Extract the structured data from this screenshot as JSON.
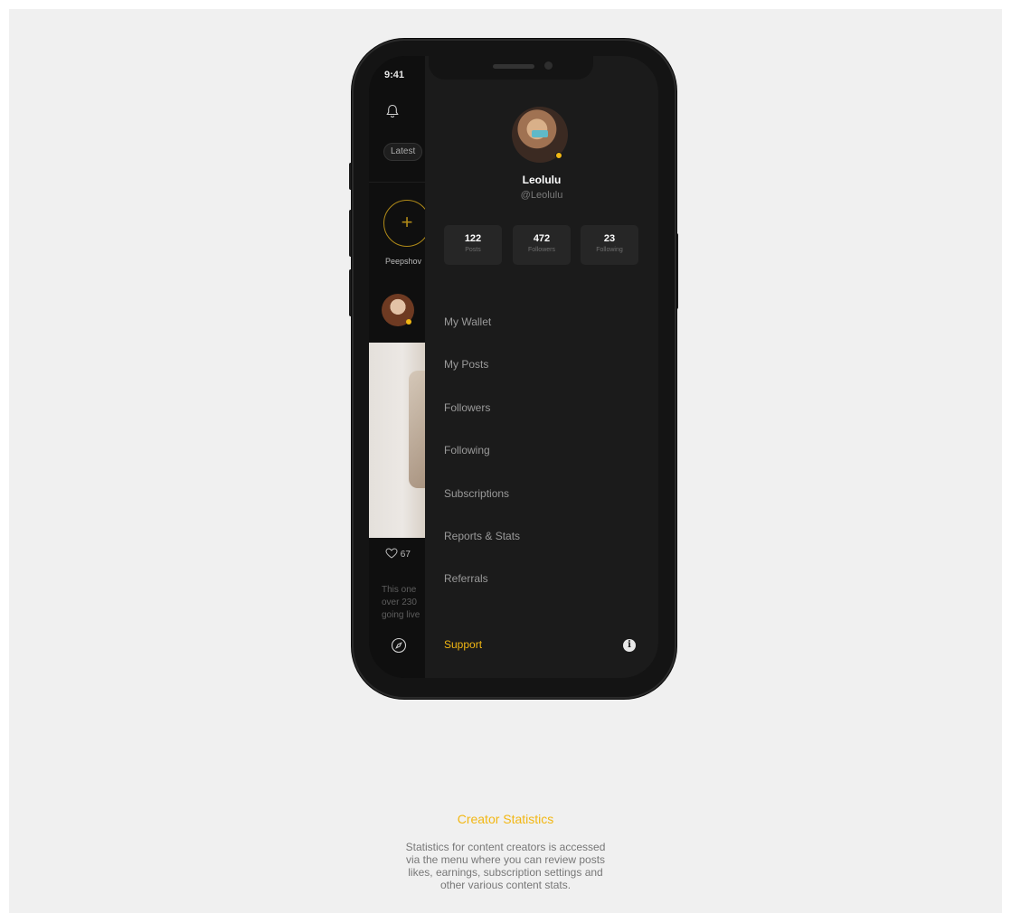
{
  "status_bar": {
    "time": "9:41"
  },
  "feed": {
    "tab_latest": "Latest",
    "story_label": "Peepshov",
    "post_meta": "",
    "likes": "67",
    "caption_lines": [
      "This one",
      "over 230",
      "going live"
    ]
  },
  "drawer": {
    "profile": {
      "name": "Leolulu",
      "handle": "@Leolulu"
    },
    "stats": [
      {
        "value": "122",
        "label": "Posts"
      },
      {
        "value": "472",
        "label": "Followers"
      },
      {
        "value": "23",
        "label": "Following"
      }
    ],
    "menu": [
      {
        "label": "My Wallet"
      },
      {
        "label": "My Posts"
      },
      {
        "label": "Followers"
      },
      {
        "label": "Following"
      },
      {
        "label": "Subscriptions"
      },
      {
        "label": "Reports & Stats"
      },
      {
        "label": "Referrals"
      }
    ],
    "support_label": "Support"
  },
  "caption": {
    "title": "Creator Statistics",
    "description_lines": [
      "Statistics for content creators is accessed",
      "via the menu where you can review posts",
      "likes, earnings, subscription settings and",
      "other various content stats."
    ]
  },
  "colors": {
    "accent": "#f2b713",
    "drawer_bg": "#1b1b1b",
    "page_bg": "#f0f0f0"
  }
}
